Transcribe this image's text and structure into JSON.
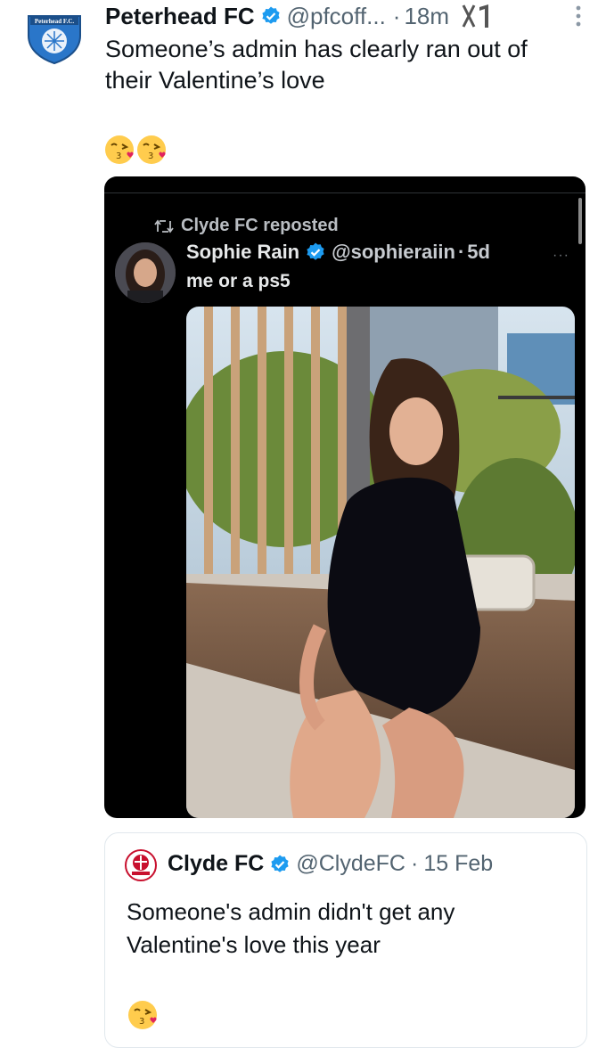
{
  "tweet": {
    "author_name": "Peterhead FC",
    "author_handle": "@pfcoff...",
    "dot": "·",
    "time": "18m",
    "avatar_text": "Peterhead F.C.",
    "text": "Someone’s admin has clearly ran out of their Valentine’s love",
    "emoji_icons": [
      "kissing-face-icon",
      "kissing-face-icon"
    ],
    "verified_color": "#1d9bf0"
  },
  "screenshot": {
    "repost_label": "Clyde FC reposted",
    "author_name": "Sophie Rain",
    "author_handle": "@sophieraiin",
    "dot": "·",
    "time": "5d",
    "text": "me or a ps5",
    "more_label": "···",
    "photo_description_icon": "photo-icon"
  },
  "quote": {
    "author_name": "Clyde FC",
    "author_handle": "@ClydeFC",
    "dot": "·",
    "date": "15 Feb",
    "text": "Someone's admin didn't get any Valentine's love this year",
    "emoji_icon": "kissing-face-icon"
  },
  "colors": {
    "verified": "#1d9bf0",
    "text_primary": "#0f1419",
    "text_secondary": "#536471"
  }
}
